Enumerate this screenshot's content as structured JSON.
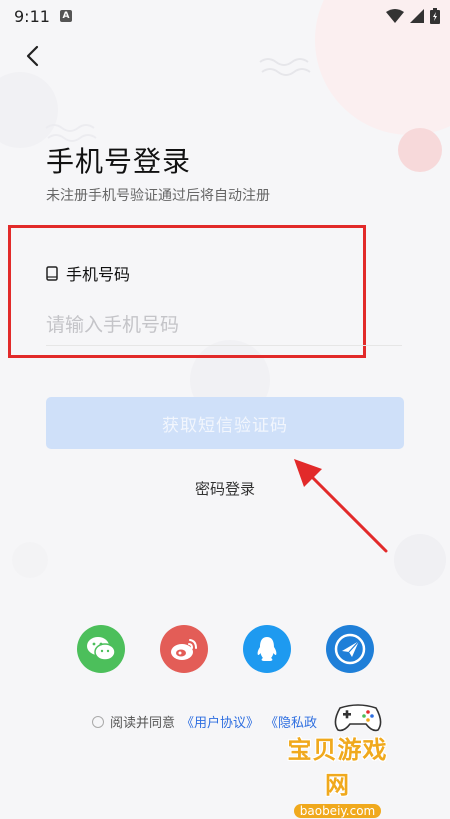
{
  "status_bar": {
    "time": "9:11",
    "notification_badge": "A",
    "icons": [
      "wifi-icon",
      "signal-icon",
      "battery-icon"
    ]
  },
  "header": {
    "back_icon": "chevron-left-icon"
  },
  "login": {
    "title": "手机号登录",
    "subtitle": "未注册手机号验证通过后将自动注册",
    "phone_label": "手机号码",
    "phone_placeholder": "请输入手机号码",
    "phone_value": "",
    "sms_button": "获取短信验证码",
    "password_login": "密码登录"
  },
  "social_logins": [
    {
      "name": "wechat",
      "icon": "wechat-icon",
      "color": "#4cbf5b"
    },
    {
      "name": "weibo",
      "icon": "weibo-icon",
      "color": "#e35d57"
    },
    {
      "name": "qq",
      "icon": "qq-icon",
      "color": "#1e9af0"
    },
    {
      "name": "other",
      "icon": "plane-badge-icon",
      "color": "#1f7fd8"
    }
  ],
  "agreement": {
    "prefix": "阅读并同意",
    "user_agreement": "《用户协议》",
    "privacy_policy": "《隐私政"
  },
  "annotation": {
    "box_color": "#e22a2a",
    "arrow_color": "#e22a2a"
  },
  "watermark": {
    "title": "宝贝游戏网",
    "url": "baobeiy.com"
  },
  "colors": {
    "accent": "#2f6fe0",
    "button_disabled": "#cfe0f9"
  }
}
